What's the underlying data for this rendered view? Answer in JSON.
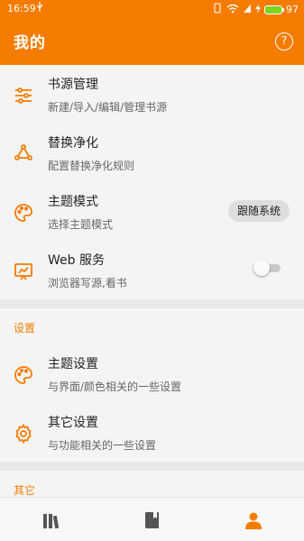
{
  "status_bar": {
    "time": "16:59",
    "usb_icon": "usb-icon",
    "battery_level": "97"
  },
  "app_bar": {
    "title": "我的",
    "help_icon": "help-circle-icon",
    "help_label": "?"
  },
  "main_items": [
    {
      "icon": "sliders-icon",
      "title": "书源管理",
      "subtitle": "新建/导入/编辑/管理书源"
    },
    {
      "icon": "recycle-icon",
      "title": "替换净化",
      "subtitle": "配置替换净化规则"
    },
    {
      "icon": "palette-icon",
      "title": "主题模式",
      "subtitle": "选择主题模式",
      "value": "跟随系统"
    },
    {
      "icon": "web-service-icon",
      "title": "Web 服务",
      "subtitle": "浏览器写源,看书",
      "toggle": false
    }
  ],
  "settings_section": {
    "header": "设置",
    "items": [
      {
        "icon": "palette-icon",
        "title": "主题设置",
        "subtitle": "与界面/颜色相关的一些设置"
      },
      {
        "icon": "gear-icon",
        "title": "其它设置",
        "subtitle": "与功能相关的一些设置"
      }
    ]
  },
  "other_section": {
    "header": "其它"
  },
  "bottom_nav": [
    {
      "icon": "bookshelf-icon",
      "active": false
    },
    {
      "icon": "explore-book-icon",
      "active": false
    },
    {
      "icon": "person-icon",
      "active": true
    }
  ],
  "colors": {
    "accent": "#f57c00",
    "icon_inactive": "#555555"
  }
}
